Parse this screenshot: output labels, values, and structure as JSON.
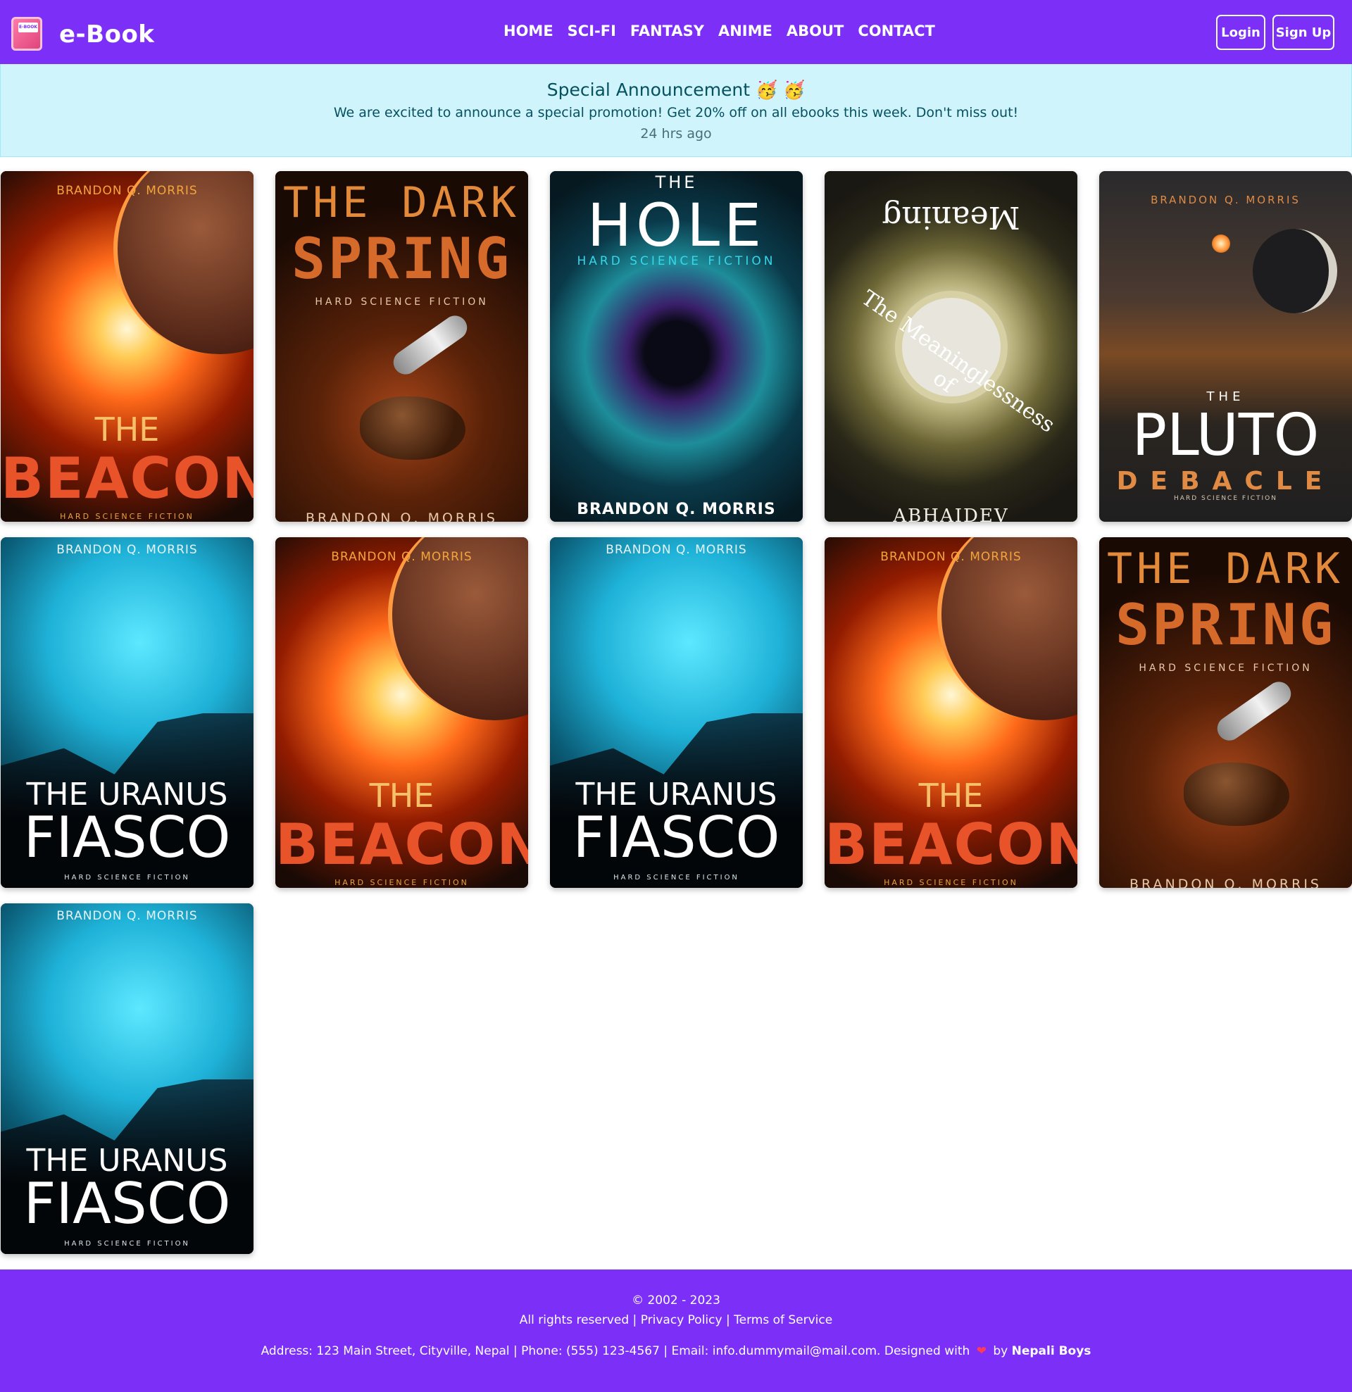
{
  "navbar": {
    "brand": "e-Book",
    "logo_tag": "E-BOOK",
    "links": [
      "HOME",
      "SCI-FI",
      "FANTASY",
      "ANIME",
      "ABOUT",
      "CONTACT"
    ],
    "login": "Login",
    "signup": "Sign Up",
    "background": "#7b2ff7"
  },
  "announcement": {
    "title": "Special Announcement 🥳 🥳",
    "message": "We are excited to announce a special promotion! Get 20% off on all ebooks this week. Don't miss out!",
    "time": "24 hrs ago"
  },
  "books": [
    {
      "cover": "beacon",
      "author": "BRANDON Q. MORRIS",
      "line1": "THE",
      "line2": "BEACON",
      "line3": "HARD SCIENCE FICTION"
    },
    {
      "cover": "spring",
      "author": "",
      "line1": "THE DARK",
      "line2": "SPRING",
      "line3": "HARD SCIENCE FICTION",
      "line4": "BRANDON Q. MORRIS"
    },
    {
      "cover": "hole",
      "author": "",
      "line1": "THE",
      "line2": "HOLE",
      "line3": "HARD SCIENCE FICTION",
      "line4": "BRANDON Q. MORRIS"
    },
    {
      "cover": "meaning",
      "author": "",
      "line1": "Meaning",
      "line2": "The Meaninglessness of",
      "line3": "ABHAIDEV"
    },
    {
      "cover": "pluto",
      "author": "BRANDON Q. MORRIS",
      "line1": "THE",
      "line2": "PLUTO",
      "line3": "DEBACLE",
      "line4": "HARD SCIENCE FICTION"
    },
    {
      "cover": "uranus",
      "author": "BRANDON Q. MORRIS",
      "line1": "THE URANUS",
      "line2": "FIASCO",
      "line3": "HARD SCIENCE FICTION"
    },
    {
      "cover": "beacon",
      "author": "BRANDON Q. MORRIS",
      "line1": "THE",
      "line2": "BEACON",
      "line3": "HARD SCIENCE FICTION"
    },
    {
      "cover": "uranus",
      "author": "BRANDON Q. MORRIS",
      "line1": "THE URANUS",
      "line2": "FIASCO",
      "line3": "HARD SCIENCE FICTION"
    },
    {
      "cover": "beacon",
      "author": "BRANDON Q. MORRIS",
      "line1": "THE",
      "line2": "BEACON",
      "line3": "HARD SCIENCE FICTION"
    },
    {
      "cover": "spring",
      "author": "",
      "line1": "THE DARK",
      "line2": "SPRING",
      "line3": "HARD SCIENCE FICTION",
      "line4": "BRANDON Q. MORRIS"
    },
    {
      "cover": "uranus",
      "author": "BRANDON Q. MORRIS",
      "line1": "THE URANUS",
      "line2": "FIASCO",
      "line3": "HARD SCIENCE FICTION"
    }
  ],
  "footer": {
    "copyright": "© 2002 - 2023",
    "rights": "All rights reserved",
    "privacy": "Privacy Policy",
    "terms": "Terms of Service",
    "info_prefix": "Address: 123 Main Street, Cityville, Nepal | Phone: (555) 123-4567 | Email: info.dummymail@mail.com. Designed with",
    "heart": "❤",
    "by": "by",
    "designer": "Nepali Boys"
  }
}
